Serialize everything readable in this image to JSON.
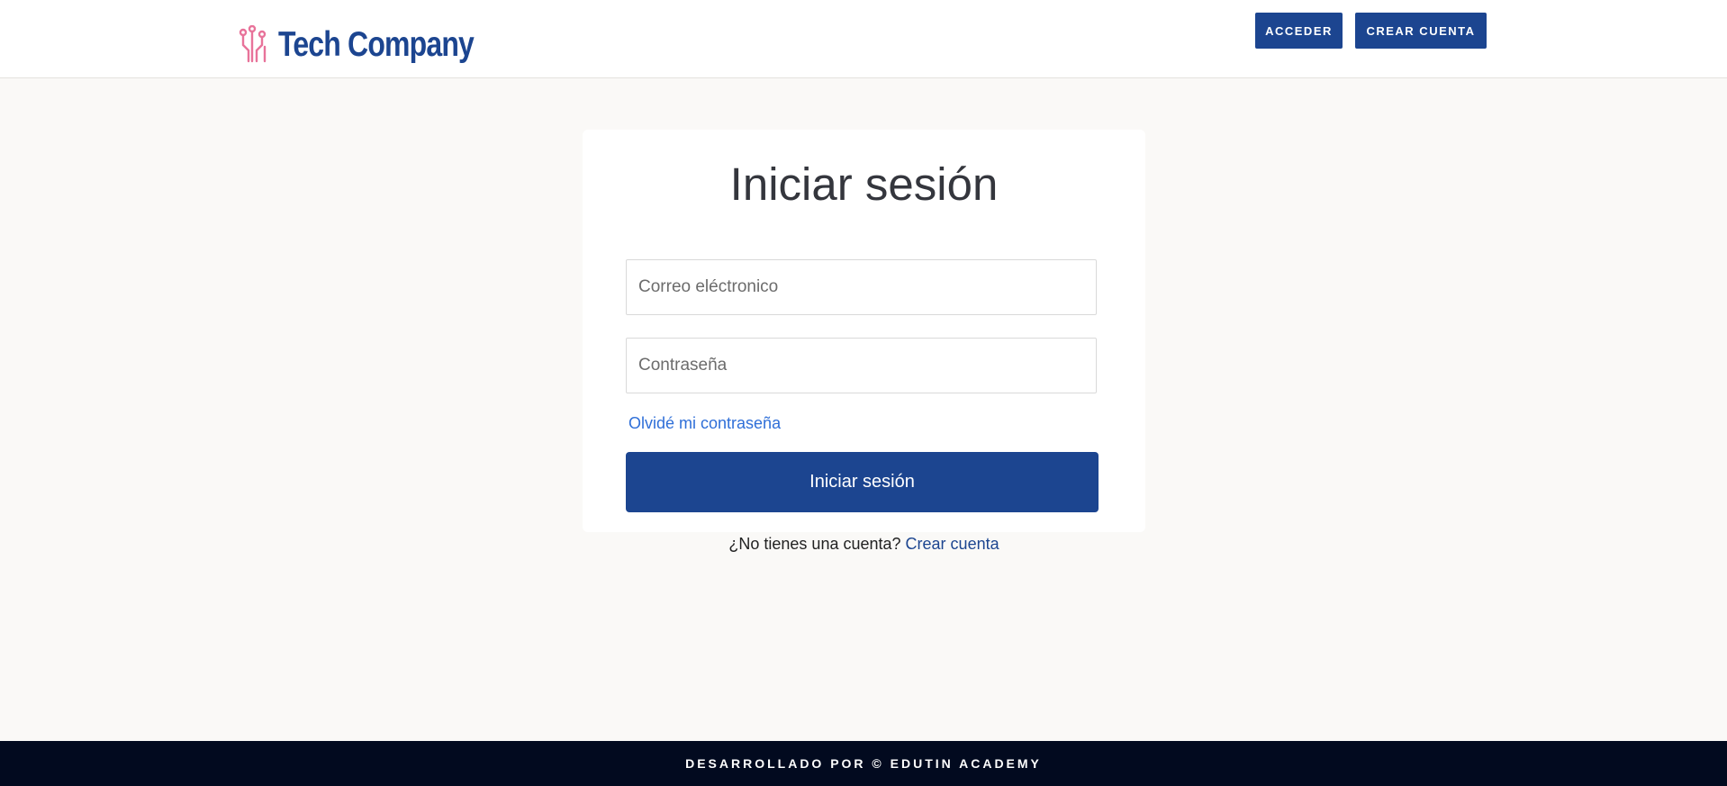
{
  "header": {
    "brand_name": "Tech Company",
    "brand_icon": "circuit-icon",
    "brand_color": "#1c4590",
    "brand_icon_color": "#e8739a",
    "nav": {
      "login_label": "ACCEDER",
      "register_label": "CREAR CUENTA"
    }
  },
  "login_form": {
    "title": "Iniciar sesión",
    "email_placeholder": "Correo eléctronico",
    "password_placeholder": "Contraseña",
    "forgot_label": "Olvidé mi contraseña",
    "submit_label": "Iniciar sesión"
  },
  "signup_prompt": {
    "text": "¿No tienes una cuenta?",
    "link_label": "Crear cuenta"
  },
  "footer": {
    "text": "DESARROLLADO POR © EDUTIN ACADEMY"
  },
  "colors": {
    "primary": "#1c4590",
    "link": "#2f6fd8",
    "page_background": "#faf9f7",
    "footer_background": "#020a1f"
  }
}
